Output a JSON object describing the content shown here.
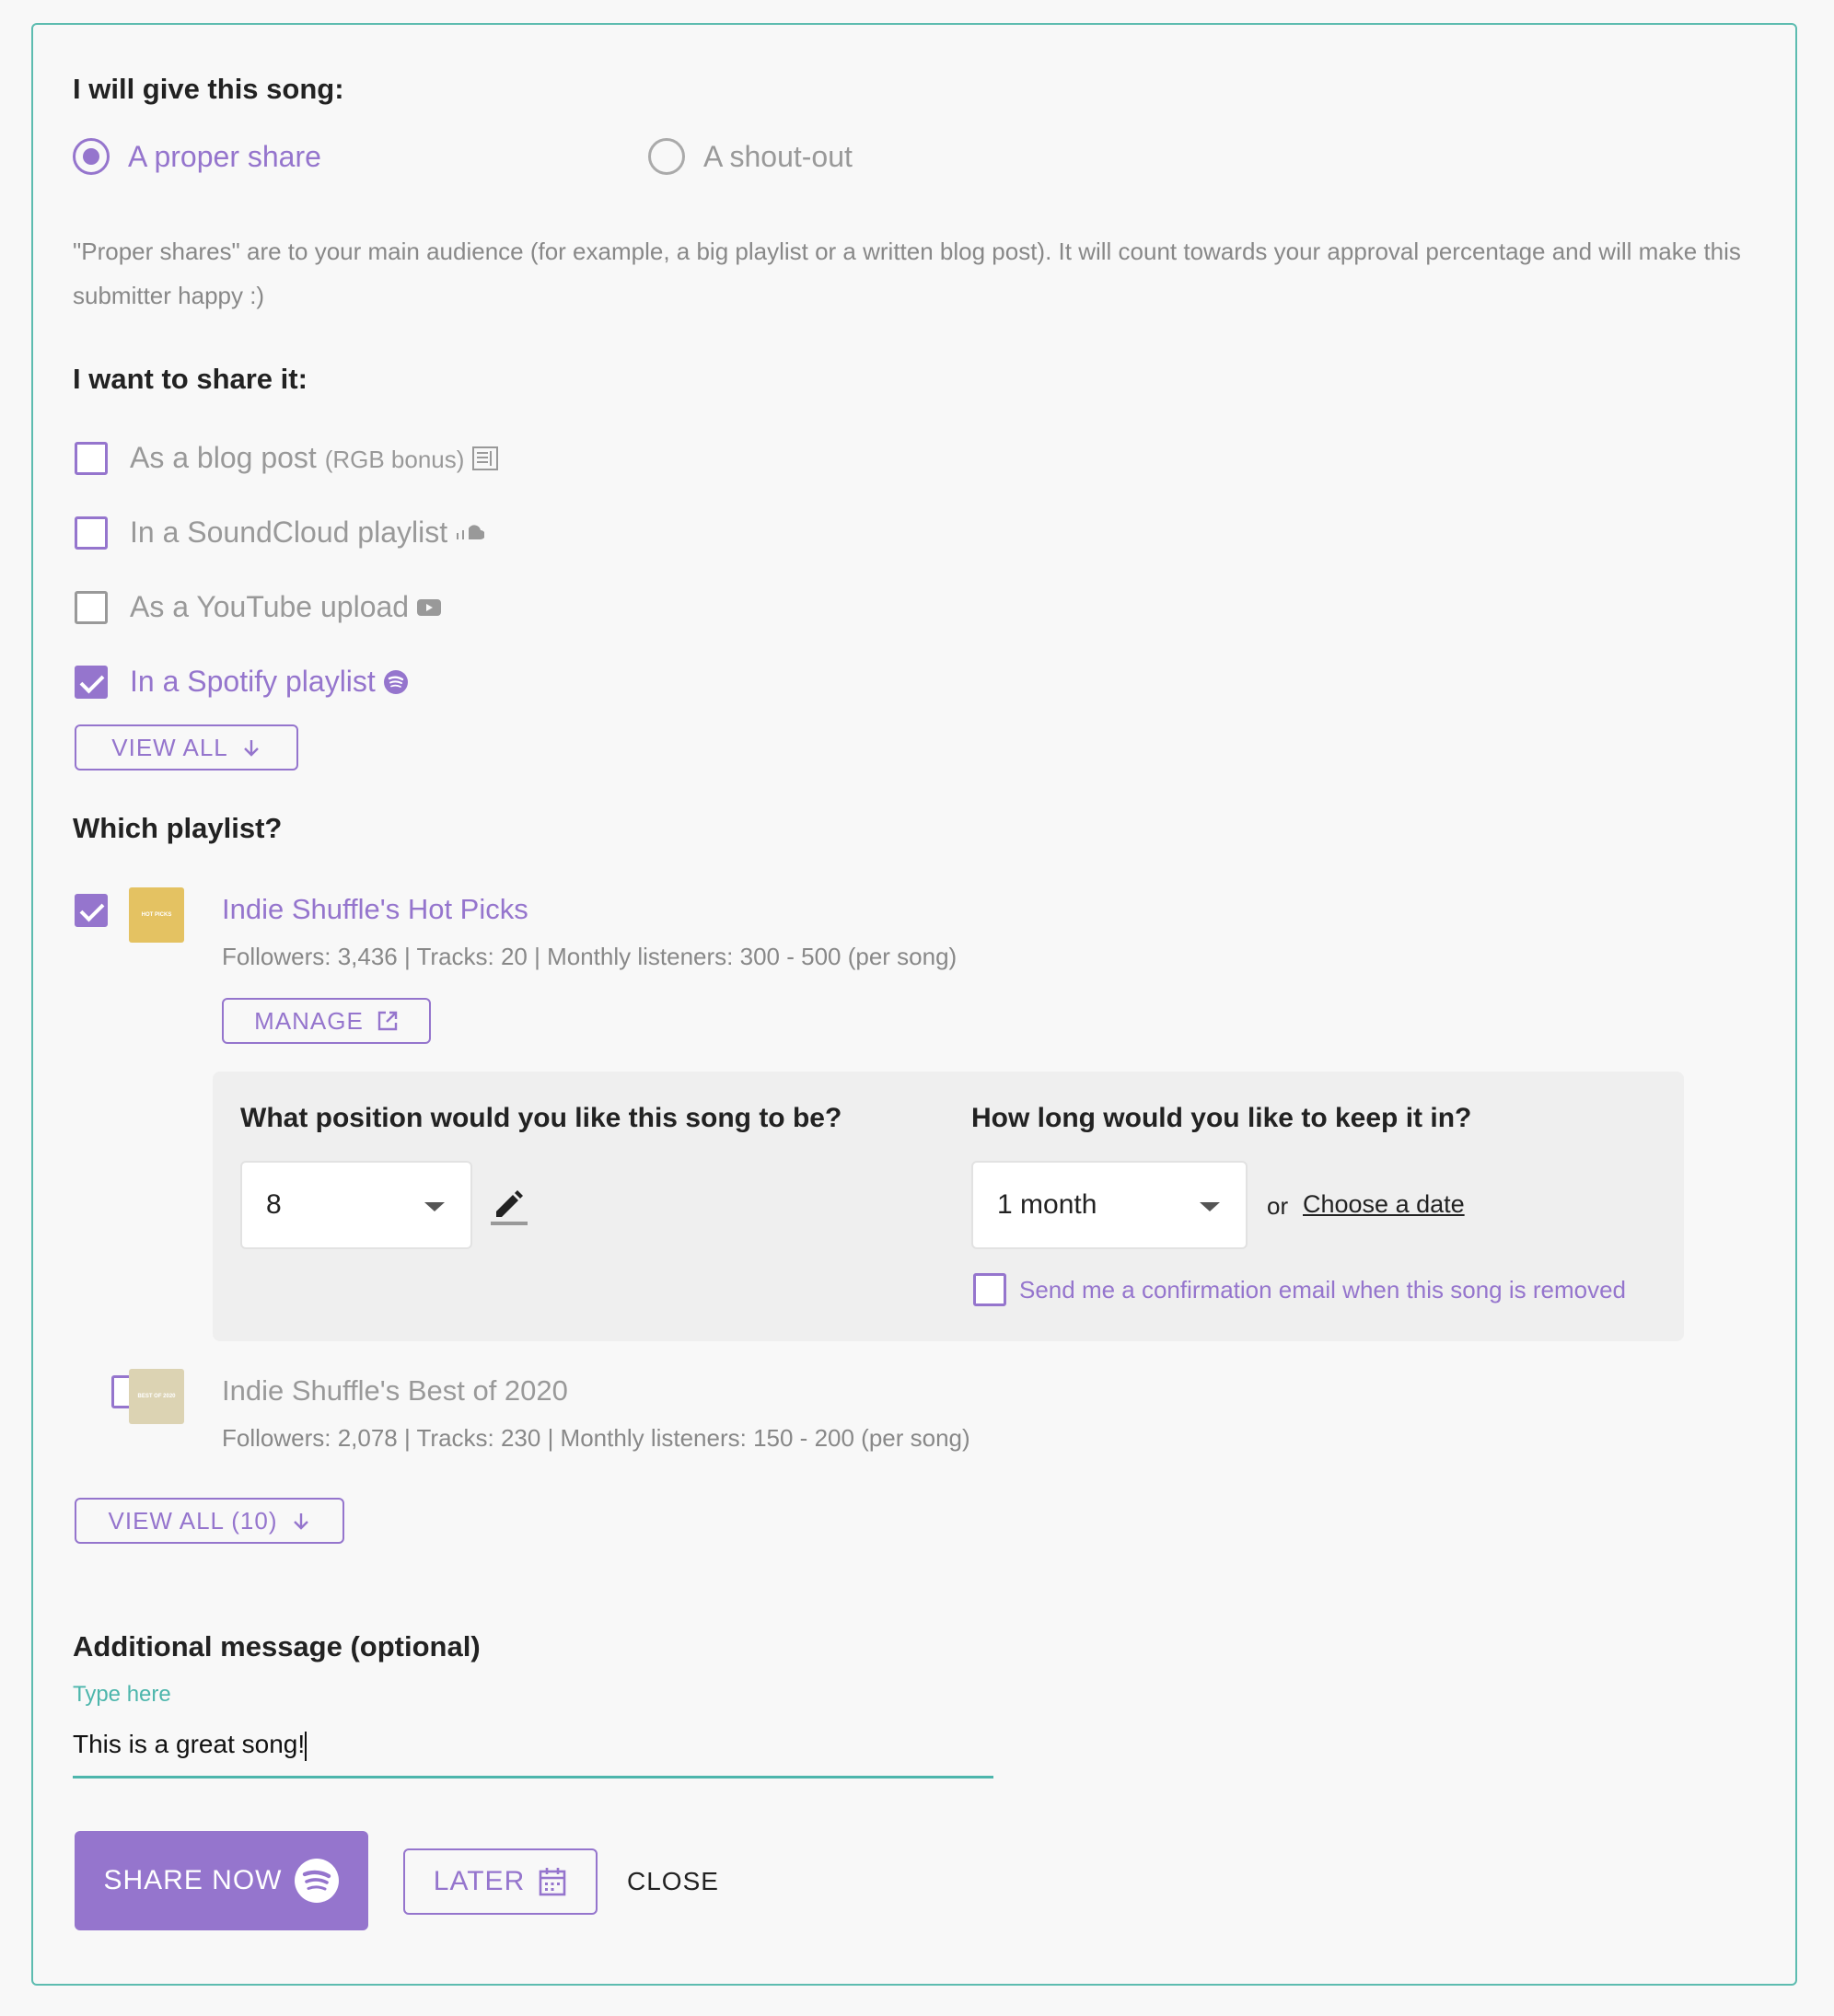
{
  "give": {
    "heading": "I will give this song:",
    "option_proper": "A proper share",
    "option_shoutout": "A shout-out",
    "description": "\"Proper shares\" are to your main audience (for example, a big playlist or a written blog post). It will count towards your approval percentage and will make this submitter happy :)"
  },
  "share": {
    "heading": "I want to share it:",
    "options": [
      {
        "label": "As a blog post",
        "note": "(RGB bonus)",
        "icon": "newspaper-icon",
        "checked": false
      },
      {
        "label": "In a SoundCloud playlist",
        "icon": "soundcloud-icon",
        "checked": false
      },
      {
        "label": "As a YouTube upload",
        "icon": "youtube-icon",
        "checked": false
      },
      {
        "label": "In a Spotify playlist",
        "icon": "spotify-icon",
        "checked": true
      }
    ],
    "view_all": "VIEW ALL"
  },
  "playlist": {
    "heading": "Which playlist?",
    "items": [
      {
        "title": "Indie Shuffle's Hot Picks",
        "meta": "Followers: 3,436 | Tracks: 20 | Monthly listeners: 300 - 500 (per song)",
        "checked": true,
        "thumb_text": "HOT PICKS",
        "thumb_color": "#e4c262"
      },
      {
        "title": "Indie Shuffle's Best of 2020",
        "meta": "Followers: 2,078 | Tracks: 230 | Monthly listeners: 150 - 200 (per song)",
        "checked": false,
        "thumb_text": "BEST OF 2020",
        "thumb_color": "#dcd3b3"
      }
    ],
    "manage": "MANAGE",
    "view_all": "VIEW ALL (10)"
  },
  "position": {
    "question": "What position would you like this song to be?",
    "value": "8"
  },
  "duration": {
    "question": "How long would you like to keep it in?",
    "value": "1 month",
    "or": "or",
    "choose_date": "Choose a date",
    "confirm_email": "Send me a confirmation email when this song is removed"
  },
  "message": {
    "heading": "Additional message (optional)",
    "label": "Type here",
    "value": "This is a great song!"
  },
  "actions": {
    "share_now": "SHARE NOW",
    "later": "LATER",
    "close": "CLOSE"
  },
  "colors": {
    "accent": "#9575cd",
    "teal": "#4db6ac"
  }
}
